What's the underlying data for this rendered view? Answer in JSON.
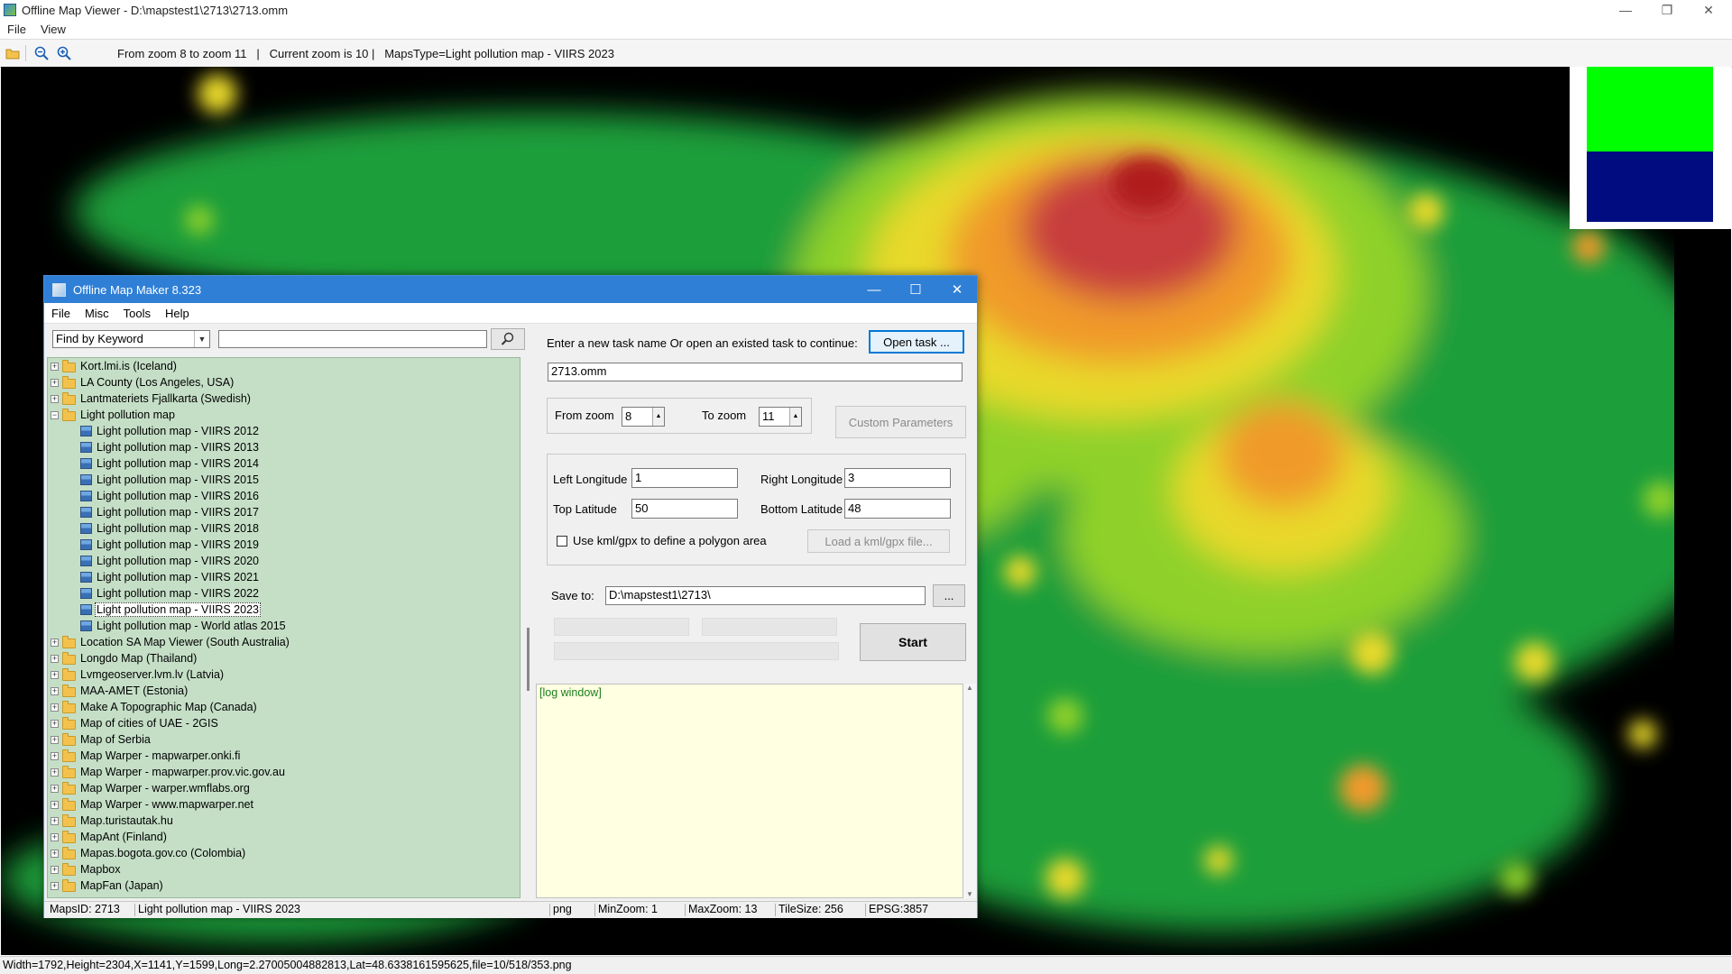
{
  "viewer": {
    "title": "Offline Map Viewer - D:\\mapstest1\\2713\\2713.omm",
    "menu": [
      "File",
      "View"
    ],
    "toolbar_status": "From zoom 8 to zoom 11   |   Current zoom is 10 |   MapsType=Light pollution map - VIIRS 2023",
    "bottom_status": "Width=1792,Height=2304,X=1141,Y=1599,Long=2.27005004882813,Lat=48.6338161595625,file=10/518/353.png"
  },
  "dialog": {
    "title": "Offline Map Maker 8.323",
    "menu": [
      "File",
      "Misc",
      "Tools",
      "Help"
    ],
    "find_mode": "Find by Keyword",
    "find_query": "",
    "tree": [
      {
        "label": "Kort.lmi.is (Iceland)",
        "level": 0,
        "type": "folder",
        "expanded": false
      },
      {
        "label": "LA County (Los Angeles, USA)",
        "level": 0,
        "type": "folder",
        "expanded": false
      },
      {
        "label": "Lantmateriets Fjallkarta (Swedish)",
        "level": 0,
        "type": "folder",
        "expanded": false
      },
      {
        "label": "Light pollution map",
        "level": 0,
        "type": "folder-open",
        "expanded": true
      },
      {
        "label": "Light pollution map - VIIRS 2012",
        "level": 1,
        "type": "map"
      },
      {
        "label": "Light pollution map - VIIRS 2013",
        "level": 1,
        "type": "map"
      },
      {
        "label": "Light pollution map - VIIRS 2014",
        "level": 1,
        "type": "map"
      },
      {
        "label": "Light pollution map - VIIRS 2015",
        "level": 1,
        "type": "map"
      },
      {
        "label": "Light pollution map - VIIRS 2016",
        "level": 1,
        "type": "map"
      },
      {
        "label": "Light pollution map - VIIRS 2017",
        "level": 1,
        "type": "map"
      },
      {
        "label": "Light pollution map - VIIRS 2018",
        "level": 1,
        "type": "map"
      },
      {
        "label": "Light pollution map - VIIRS 2019",
        "level": 1,
        "type": "map"
      },
      {
        "label": "Light pollution map - VIIRS 2020",
        "level": 1,
        "type": "map"
      },
      {
        "label": "Light pollution map - VIIRS 2021",
        "level": 1,
        "type": "map"
      },
      {
        "label": "Light pollution map - VIIRS 2022",
        "level": 1,
        "type": "map"
      },
      {
        "label": "Light pollution map - VIIRS 2023",
        "level": 1,
        "type": "map",
        "selected": true
      },
      {
        "label": "Light pollution map - World atlas 2015",
        "level": 1,
        "type": "map"
      },
      {
        "label": "Location SA Map Viewer (South Australia)",
        "level": 0,
        "type": "folder",
        "expanded": false
      },
      {
        "label": "Longdo Map (Thailand)",
        "level": 0,
        "type": "folder",
        "expanded": false
      },
      {
        "label": "Lvmgeoserver.lvm.lv (Latvia)",
        "level": 0,
        "type": "folder",
        "expanded": false
      },
      {
        "label": "MAA-AMET (Estonia)",
        "level": 0,
        "type": "folder",
        "expanded": false
      },
      {
        "label": "Make A Topographic Map (Canada)",
        "level": 0,
        "type": "folder",
        "expanded": false
      },
      {
        "label": "Map of cities of UAE - 2GIS",
        "level": 0,
        "type": "folder",
        "expanded": false
      },
      {
        "label": "Map of Serbia",
        "level": 0,
        "type": "folder",
        "expanded": false
      },
      {
        "label": "Map Warper - mapwarper.onki.fi",
        "level": 0,
        "type": "folder",
        "expanded": false
      },
      {
        "label": "Map Warper - mapwarper.prov.vic.gov.au",
        "level": 0,
        "type": "folder",
        "expanded": false
      },
      {
        "label": "Map Warper - warper.wmflabs.org",
        "level": 0,
        "type": "folder",
        "expanded": false
      },
      {
        "label": "Map Warper - www.mapwarper.net",
        "level": 0,
        "type": "folder",
        "expanded": false
      },
      {
        "label": "Map.turistautak.hu",
        "level": 0,
        "type": "folder",
        "expanded": false
      },
      {
        "label": "MapAnt (Finland)",
        "level": 0,
        "type": "folder",
        "expanded": false
      },
      {
        "label": "Mapas.bogota.gov.co (Colombia)",
        "level": 0,
        "type": "folder",
        "expanded": false
      },
      {
        "label": "Mapbox",
        "level": 0,
        "type": "folder",
        "expanded": false
      },
      {
        "label": "MapFan (Japan)",
        "level": 0,
        "type": "folder",
        "expanded": false
      }
    ],
    "task_prompt": "Enter a new task name Or open an existed task to continue:",
    "open_task_label": "Open task ...",
    "task_name": "2713.omm",
    "from_zoom_label": "From zoom",
    "from_zoom": "8",
    "to_zoom_label": "To zoom",
    "to_zoom": "11",
    "custom_params_label": "Custom Parameters",
    "left_lon_label": "Left Longitude",
    "left_lon": "1",
    "right_lon_label": "Right Longitude",
    "right_lon": "3",
    "top_lat_label": "Top Latitude",
    "top_lat": "50",
    "bottom_lat_label": "Bottom Latitude",
    "bottom_lat": "48",
    "kml_label": "Use kml/gpx to define a polygon area",
    "load_kml_label": "Load a kml/gpx file...",
    "save_to_label": "Save to:",
    "save_to": "D:\\mapstest1\\2713\\",
    "browse_label": "...",
    "start_label": "Start",
    "log_text": "[log window]",
    "status": {
      "maps_id": "MapsID: 2713",
      "map_name": "Light pollution map - VIIRS 2023",
      "format": "png",
      "min_zoom": "MinZoom: 1",
      "max_zoom": "MaxZoom: 13",
      "tile_size": "TileSize: 256",
      "epsg": "EPSG:3857"
    }
  }
}
